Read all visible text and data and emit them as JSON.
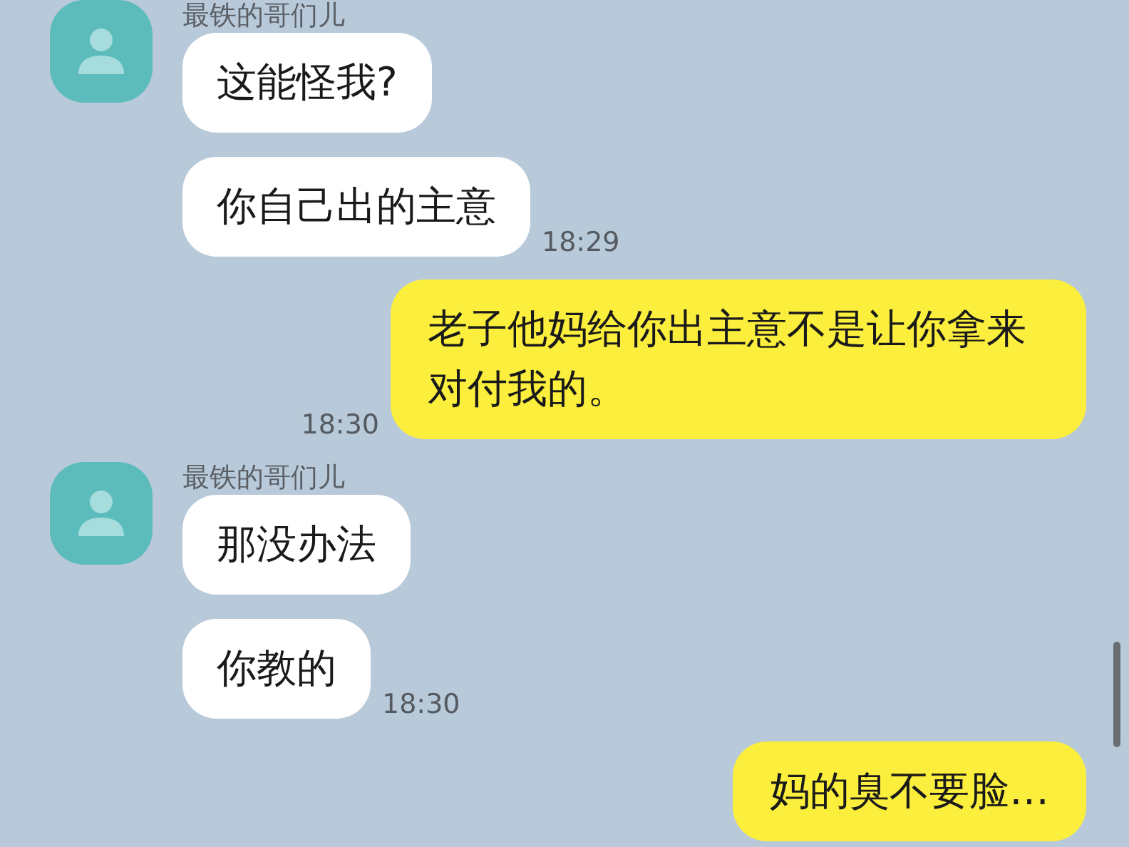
{
  "messages": [
    {
      "kind": "incoming",
      "sender": "最铁的哥们儿",
      "bubbles": [
        "这能怪我?",
        "你自己出的主意"
      ],
      "time": "18:29"
    },
    {
      "kind": "outgoing",
      "text": "老子他妈给你出主意不是让你拿来对付我的。",
      "time": "18:30"
    },
    {
      "kind": "incoming",
      "sender": "最铁的哥们儿",
      "bubbles": [
        "那没办法",
        "你教的"
      ],
      "time": "18:30"
    },
    {
      "kind": "outgoing",
      "text": "妈的臭不要脸…"
    }
  ]
}
